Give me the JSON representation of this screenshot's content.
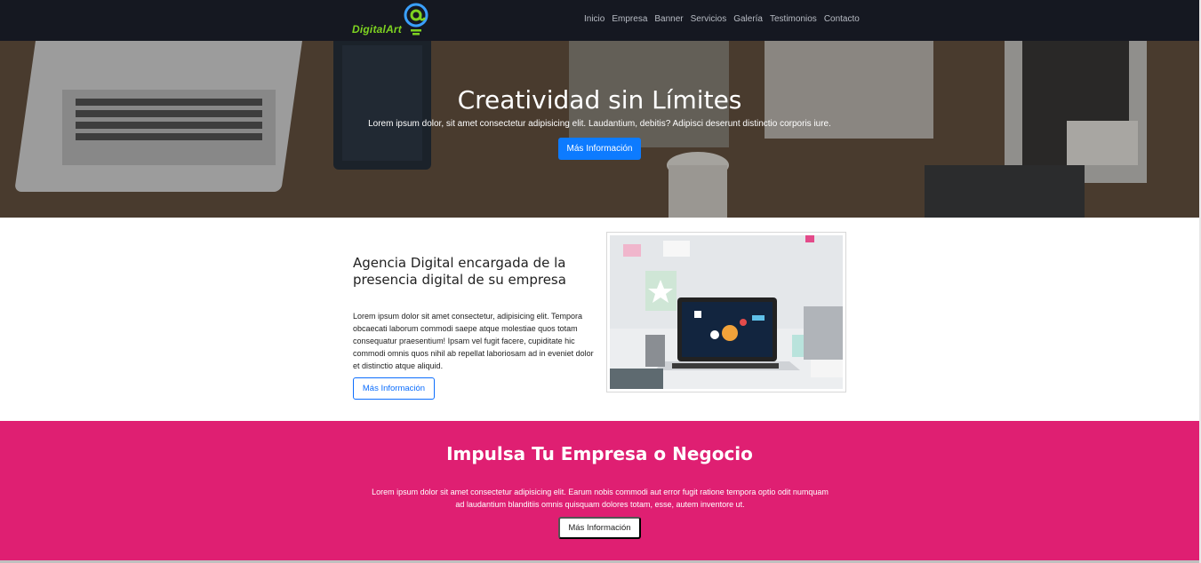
{
  "brand": {
    "name": "DigitalArt",
    "logo_icon": "at-sign-icon",
    "accent": "#7ed321"
  },
  "nav": {
    "items": [
      {
        "label": "Inicio"
      },
      {
        "label": "Empresa"
      },
      {
        "label": "Banner"
      },
      {
        "label": "Servicios"
      },
      {
        "label": "Galería"
      },
      {
        "label": "Testimonios"
      },
      {
        "label": "Contacto"
      }
    ]
  },
  "hero": {
    "title": "Creatividad sin Límites",
    "subtitle": "Lorem ipsum dolor, sit amet consectetur adipisicing elit. Laudantium, debitis? Adipisci deserunt distinctio corporis iure.",
    "button_label": "Más Información",
    "button_color": "#0d7bff"
  },
  "about": {
    "title": "Agencia Digital encargada de la presencia digital de su empresa",
    "text": "Lorem ipsum dolor sit amet consectetur, adipisicing elit. Tempora obcaecati laborum commodi saepe atque molestiae quos totam consequatur praesentium! Ipsam vel fugit facere, cupiditate hic commodi omnis quos nihil ab repellat laboriosam ad in eveniet dolor et distinctio atque aliquid.",
    "button_label": "Más Información"
  },
  "promo": {
    "title": "Impulsa Tu Empresa o Negocio",
    "text": "Lorem ipsum dolor sit amet consectetur adipisicing elit. Earum nobis commodi aut error fugit ratione tempora optio odit numquam ad laudantium blanditiis omnis quisquam dolores totam, esse, autem inventore ut.",
    "button_label": "Más Información",
    "background": "#df1f72"
  }
}
